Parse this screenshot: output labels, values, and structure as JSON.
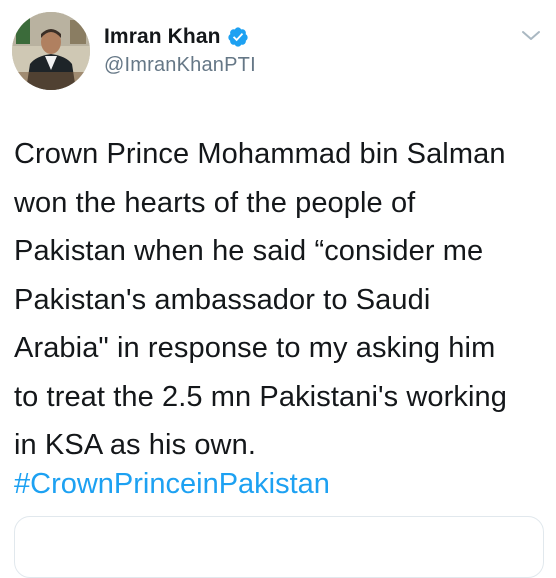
{
  "tweet": {
    "author": {
      "display_name": "Imran Khan",
      "handle": "@ImranKhanPTI",
      "verified": true
    },
    "text_lines": [
      "Crown Prince Mohammad bin Salman",
      "won the hearts of the people of",
      "Pakistan when he said “consider me",
      "Pakistan's ambassador to Saudi",
      "Arabia\" in response to my asking him",
      "to treat the 2.5 mn Pakistani's working",
      "in KSA as his own."
    ],
    "hashtag": "#CrownPrinceinPakistan"
  },
  "icons": {
    "verified": "verified-badge-icon",
    "menu": "chevron-down-icon"
  },
  "colors": {
    "link": "#1da1f2",
    "secondary_text": "#657786",
    "primary_text": "#14171a",
    "border": "#e1e8ed"
  }
}
